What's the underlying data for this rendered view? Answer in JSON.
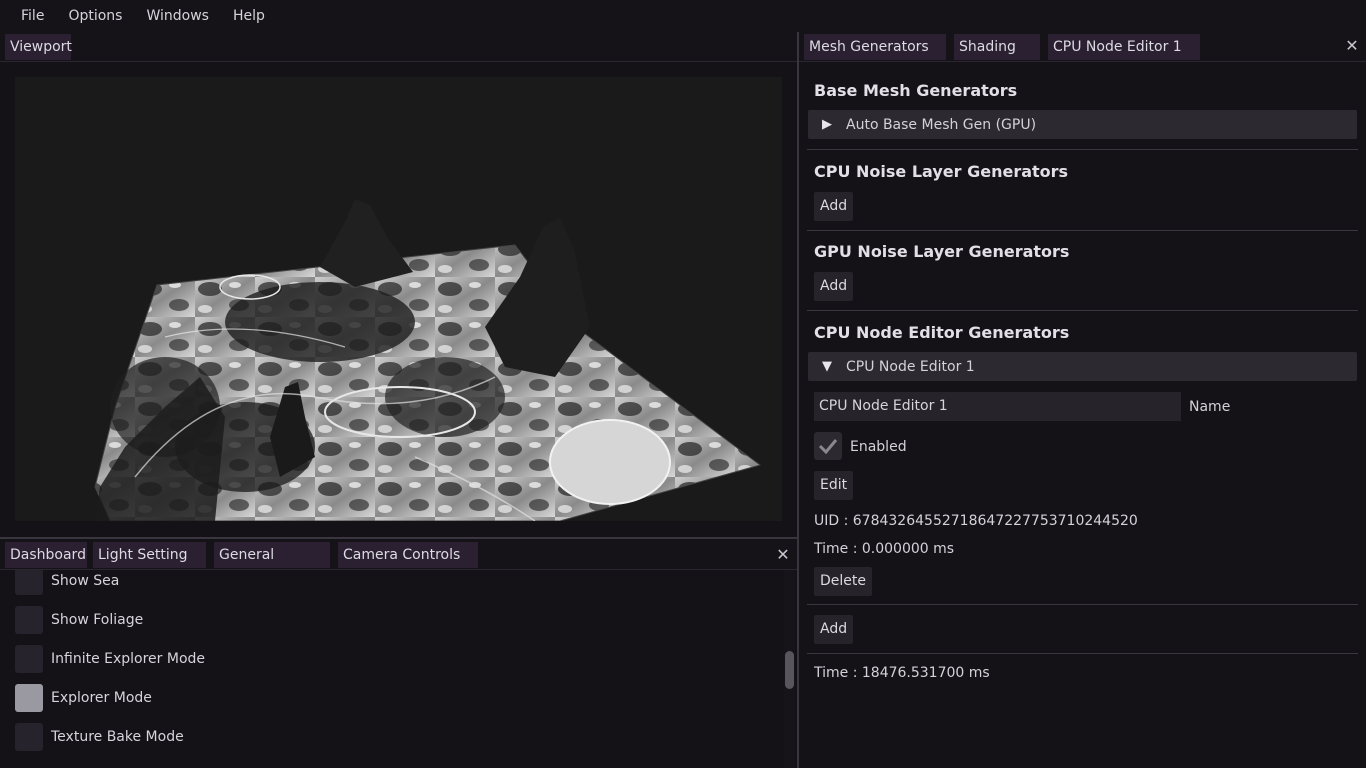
{
  "menu": [
    "File",
    "Options",
    "Windows",
    "Help"
  ],
  "viewport": {
    "tab": "Viewport"
  },
  "bottom_dock": {
    "tabs": [
      "Dashboard",
      "Light Setting",
      "General Controls",
      "Camera Controls"
    ],
    "checkboxes": [
      {
        "label": "Show Sea",
        "checked": false
      },
      {
        "label": "Show Foliage",
        "checked": false
      },
      {
        "label": "Infinite Explorer Mode",
        "checked": false
      },
      {
        "label": "Explorer Mode",
        "checked": true
      },
      {
        "label": "Texture Bake Mode",
        "checked": false
      }
    ]
  },
  "right_panel": {
    "tabs": [
      "Mesh Generators",
      "Shading",
      "CPU Node Editor 1"
    ],
    "base_mesh_title": "Base Mesh Generators",
    "auto_base_mesh": "Auto Base Mesh Gen (GPU)",
    "cpu_noise_title": "CPU Noise Layer Generators",
    "gpu_noise_title": "GPU Noise Layer Generators",
    "cpu_node_title": "CPU Node Editor Generators",
    "add_label": "Add",
    "node_editor": {
      "header": "CPU Node Editor 1",
      "name_value": "CPU Node Editor 1",
      "name_label": "Name",
      "enabled_label": "Enabled",
      "edit_label": "Edit",
      "uid": "UID : 67843264552718647227753710244520",
      "time": "Time : 0.000000 ms",
      "delete_label": "Delete"
    },
    "total_time": "Time : 18476.531700 ms"
  },
  "colors": {
    "tab_bg": "#2a2032",
    "panel_bg": "#141217",
    "button_bg": "#26232b"
  }
}
